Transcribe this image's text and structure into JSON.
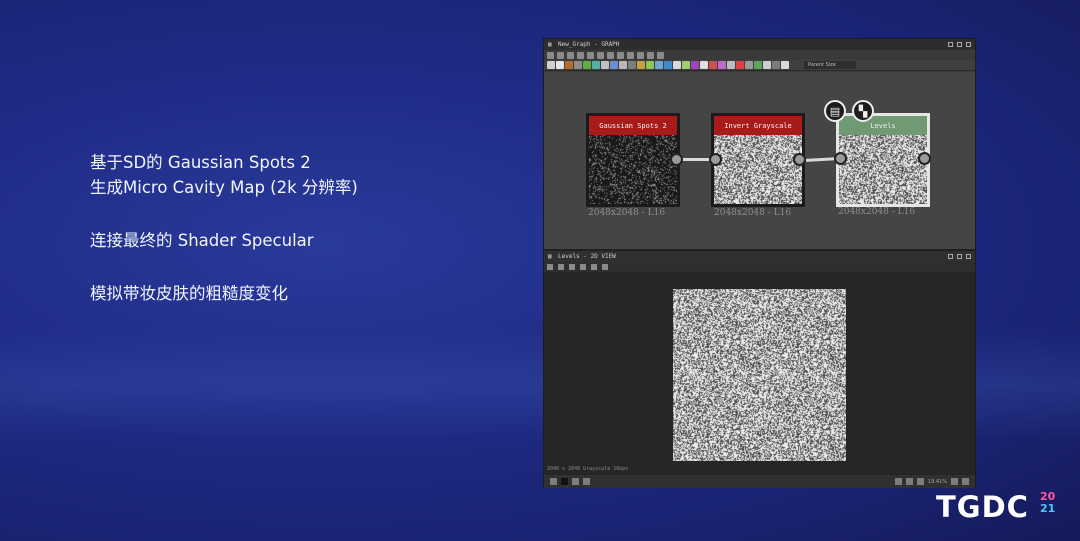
{
  "slide": {
    "line1": "基于SD的 Gaussian Spots 2",
    "line2": "生成Micro Cavity Map (2k 分辨率)",
    "line3": "连接最终的 Shader Specular",
    "line4": "模拟带妆皮肤的粗糙度变化"
  },
  "graph_panel": {
    "title": "New_Graph - GRAPH",
    "parent_size_label": "Parent Size"
  },
  "nodes": [
    {
      "label": "Gaussian Spots 2",
      "resolution": "2048x2048 - L16"
    },
    {
      "label": "Invert Grayscale",
      "resolution": "2048x2048 - L16"
    },
    {
      "label": "Levels",
      "resolution": "2048x2048 - L16"
    }
  ],
  "view_panel": {
    "title": "Levels - 2D VIEW",
    "info": "2048 x 2048 Grayscale 16bpc",
    "zoom": "19.41%"
  },
  "logo": {
    "main": "TGDC",
    "year_top": "20",
    "year_bottom": "21"
  },
  "colors": {
    "background": "#1f2b86",
    "node_header_red": "#a81b1b",
    "node_header_green": "#6f9a74",
    "logo_pink": "#ff5aa0",
    "logo_blue": "#48c7ff"
  }
}
